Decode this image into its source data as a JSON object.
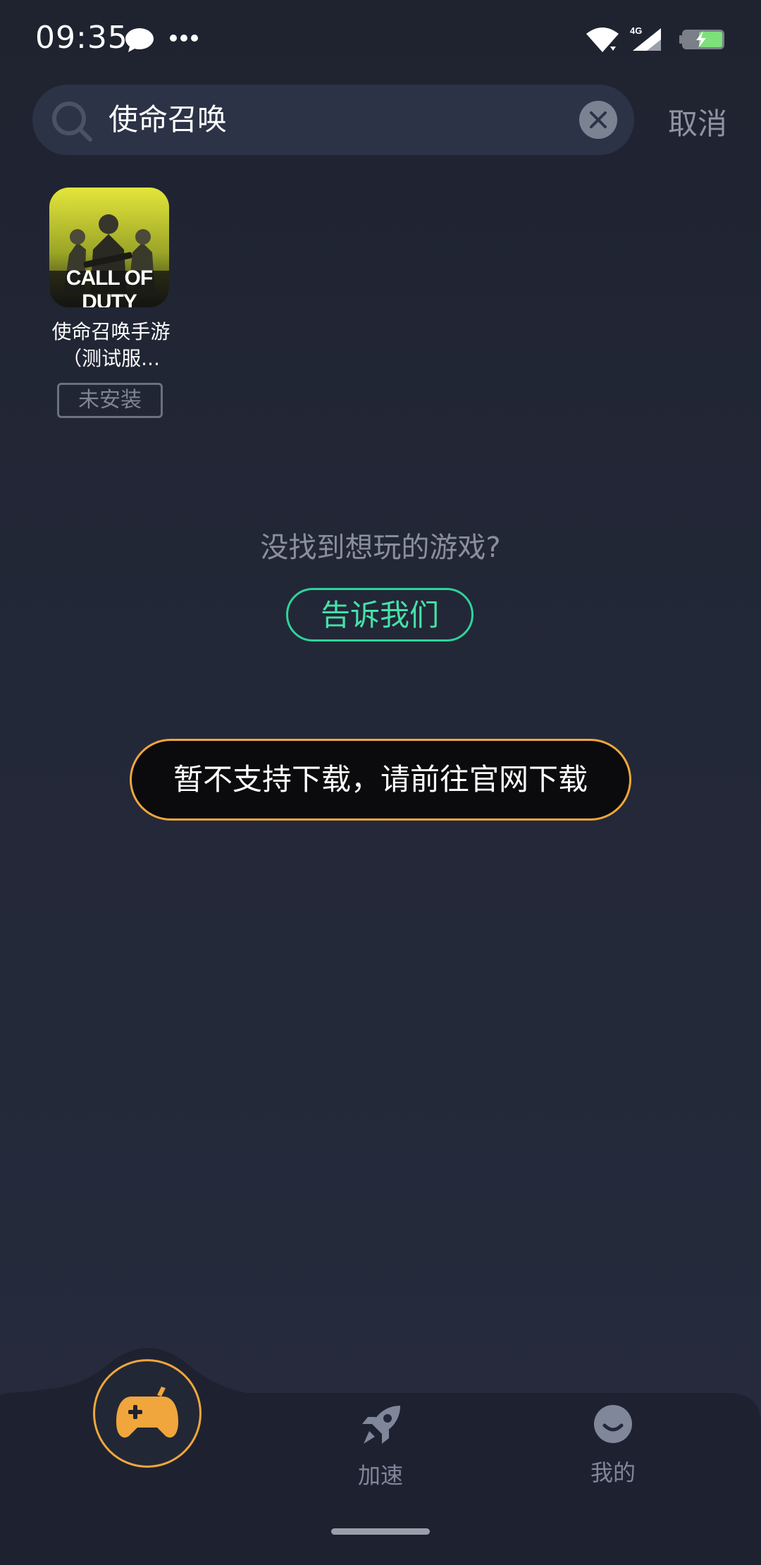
{
  "status_bar": {
    "time": "09:35",
    "network": "4G",
    "icons": [
      "message-icon",
      "more-icon",
      "wifi-icon",
      "signal-icon",
      "battery-charging-icon"
    ]
  },
  "search": {
    "value": "使命召唤",
    "cancel_label": "取消",
    "icon": "search-icon",
    "clear_icon": "close-icon"
  },
  "results": [
    {
      "title": "使命召唤手游（测试服...",
      "icon_text": "CALL OF DUTY",
      "status": "未安装"
    }
  ],
  "not_found": {
    "text": "没找到想玩的游戏?",
    "button_label": "告诉我们"
  },
  "toast": {
    "text": "暂不支持下载，请前往官网下载"
  },
  "bottom_nav": {
    "items": [
      {
        "icon": "gamepad-plus-icon",
        "label": ""
      },
      {
        "icon": "rocket-icon",
        "label": "加速"
      },
      {
        "icon": "smile-face-icon",
        "label": "我的"
      }
    ]
  },
  "colors": {
    "accent_orange": "#f0a63c",
    "accent_green": "#2fd39a",
    "background": "#232838"
  }
}
